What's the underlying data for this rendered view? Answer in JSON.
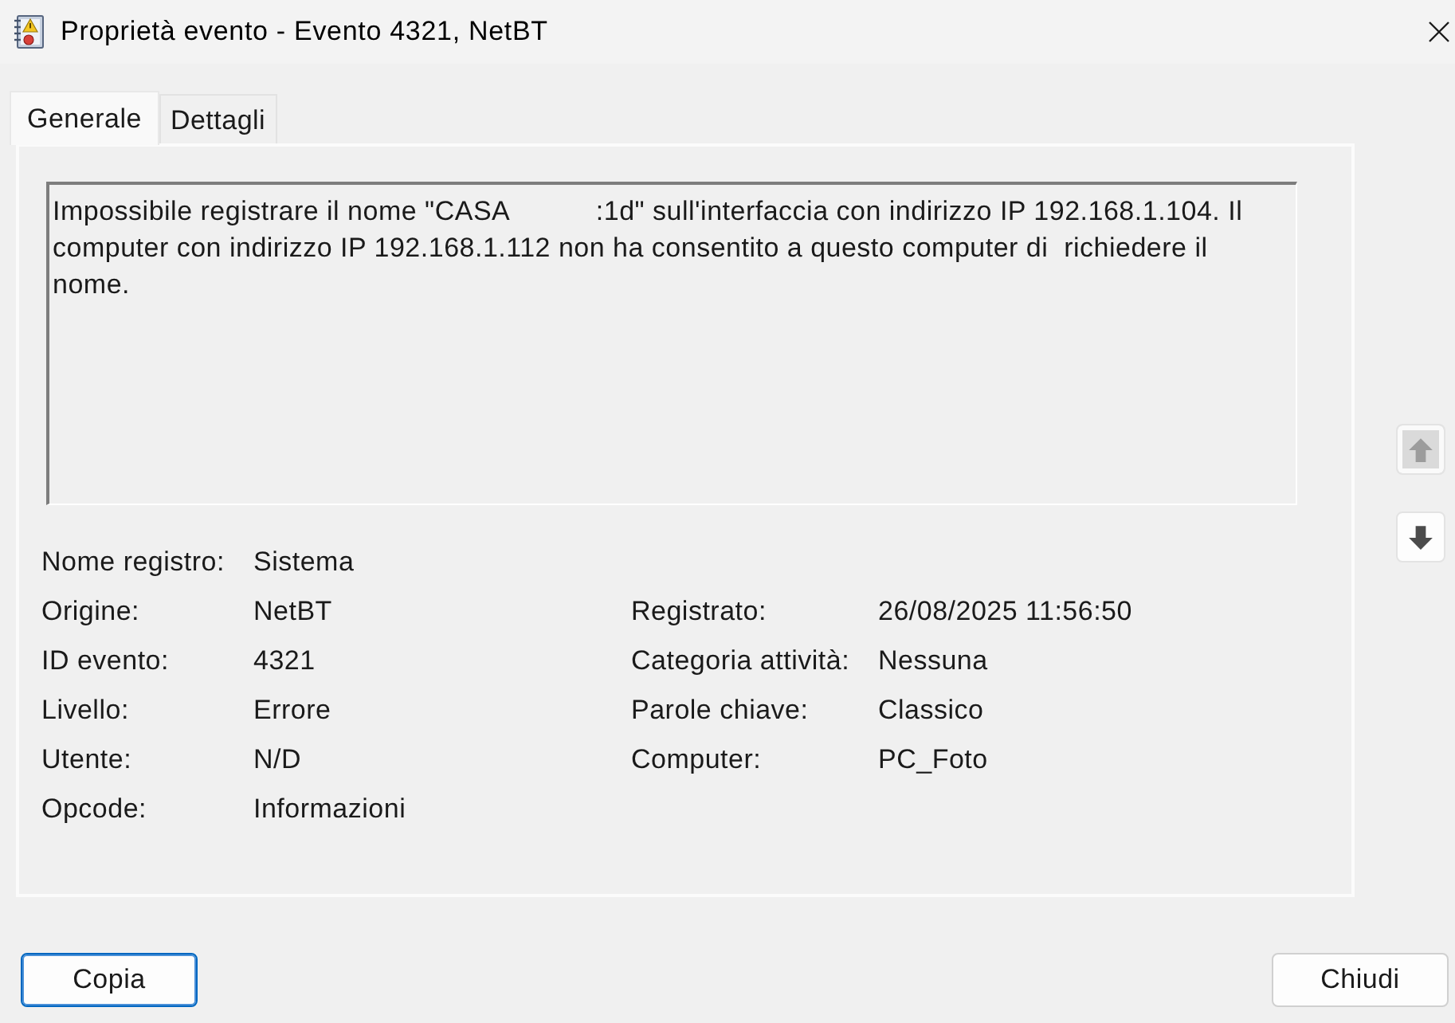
{
  "window": {
    "title": "Proprietà evento - Evento 4321, NetBT"
  },
  "tabs": [
    {
      "label": "Generale",
      "selected": true
    },
    {
      "label": "Dettagli",
      "selected": false
    }
  ],
  "description": "Impossibile registrare il nome \"CASA           :1d\" sull'interfaccia con indirizzo IP 192.168.1.104. Il computer con indirizzo IP 192.168.1.112 non ha consentito a questo computer di  richiedere il nome.",
  "fields_left": [
    {
      "label": "Nome registro:",
      "value": "Sistema"
    },
    {
      "label": "Origine:",
      "value": "NetBT"
    },
    {
      "label": "ID evento:",
      "value": "4321"
    },
    {
      "label": "Livello:",
      "value": "Errore"
    },
    {
      "label": "Utente:",
      "value": "N/D"
    },
    {
      "label": "Opcode:",
      "value": "Informazioni"
    }
  ],
  "fields_right": [
    {
      "label": "Registrato:",
      "value": "26/08/2025 11:56:50"
    },
    {
      "label": "Categoria attività:",
      "value": "Nessuna"
    },
    {
      "label": "Parole chiave:",
      "value": "Classico"
    },
    {
      "label": "Computer:",
      "value": "PC_Foto"
    }
  ],
  "nav_buttons": [
    {
      "kind": "up",
      "disabled": true
    },
    {
      "kind": "down",
      "disabled": false
    }
  ],
  "buttons": [
    {
      "label": "Copia",
      "focused": true
    },
    {
      "label": "Chiudi",
      "focused": false
    }
  ]
}
